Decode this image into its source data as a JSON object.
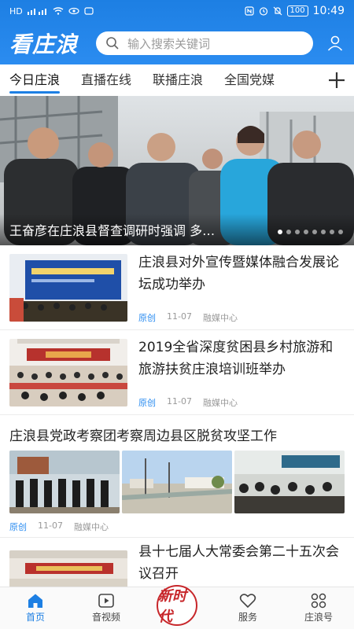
{
  "status_bar": {
    "left_text": "HD",
    "battery": "100",
    "time": "10:49"
  },
  "header": {
    "logo": "看庄浪",
    "search_placeholder": "输入搜索关键词"
  },
  "tabs": [
    {
      "label": "今日庄浪",
      "active": true
    },
    {
      "label": "直播在线",
      "active": false
    },
    {
      "label": "联播庄浪",
      "active": false
    },
    {
      "label": "全国党媒",
      "active": false
    }
  ],
  "hero": {
    "title": "王奋彦在庄浪县督查调研时强调 多…",
    "slide_count": 8,
    "active_slide": 1
  },
  "news": [
    {
      "title": "庄浪县对外宣传暨媒体融合发展论坛成功举办",
      "tag": "原创",
      "date": "11-07",
      "source": "融媒中心"
    },
    {
      "title": "2019全省深度贫困县乡村旅游和旅游扶贫庄浪培训班举办",
      "tag": "原创",
      "date": "11-07",
      "source": "融媒中心"
    },
    {
      "title": "庄浪县党政考察团考察周边县区脱贫攻坚工作",
      "tag": "原创",
      "date": "11-07",
      "source": "融媒中心"
    },
    {
      "title": "县十七届人大常委会第二十五次会议召开"
    }
  ],
  "bottom_nav": {
    "items": [
      {
        "label": "首页",
        "icon": "home-icon",
        "active": true
      },
      {
        "label": "音视频",
        "icon": "video-icon",
        "active": false
      },
      {
        "label": "新时代",
        "icon": "seal-logo",
        "active": false
      },
      {
        "label": "服务",
        "icon": "heart-icon",
        "active": false
      },
      {
        "label": "庄浪号",
        "icon": "grid-icon",
        "active": false
      }
    ]
  },
  "colors": {
    "brand_blue": "#1d7fe3",
    "accent_red": "#c7262a",
    "meta_gray": "#999999"
  }
}
